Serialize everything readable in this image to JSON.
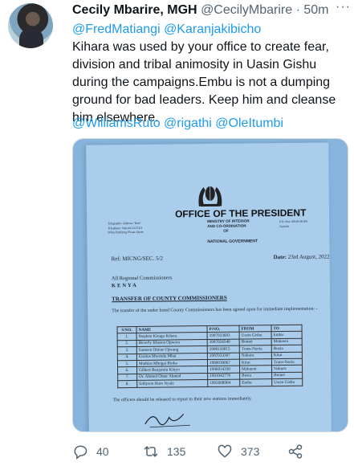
{
  "tweet": {
    "author_name": "Cecily Mbarire, MGH",
    "author_handle": "@CecilyMbarire",
    "separator": "·",
    "time": "50m",
    "mentions": "@FredMatiangi @Karanjakibicho",
    "text": "Kihara was used by your office to create fear, division  and tribal animosity in Uasin Gishu during the campaigns.Embu is not a dumping ground for bad leaders. Keep him and cleanse him elsewhere.",
    "tags": "@WilliamsRuto @rigathi @OleItumbi",
    "more_icon": "more-icon"
  },
  "letter": {
    "office": "OFFICE OF THE PRESIDENT",
    "ministry_lines": [
      "MINISTRY OF INTERIOR",
      "AND CO-ORDINATION",
      "OF"
    ],
    "government": "NATIONAL GOVERNMENT",
    "tel_lines": [
      "Telegraphic Address \"Rais\"",
      "Telephone: Nairobi 2227411",
      "When Replying Please Quote"
    ],
    "pobox_lines": [
      "P.O. Box 30510-00100",
      "Nairobi"
    ],
    "ref": "Ref:   MICNG/SEC. 5/2",
    "date_label": "Date:",
    "date_value": "23rd August, 2022",
    "addressee": "All Regional Commissioners",
    "country": "KENYA",
    "subject": "TRANSFER OF COUNTY COMMISSIONERS",
    "intro": "The transfer of the under listed County Commissioners has been agreed upon for immediate implementation: -",
    "table": {
      "headers": [
        "S/NO.",
        "NAME",
        "P/NO.",
        "FROM",
        "TO"
      ],
      "rows": [
        [
          "1.",
          "Stephen Kiragu Kihara",
          "1997023683",
          "Uasin Gishu",
          "Embu"
        ],
        [
          "2.",
          "Beverly Khasoa Opwora",
          "1997024540",
          "Bomet",
          "Makueni"
        ],
        [
          "3.",
          "Samson Otieno Ojwang",
          "1990110015",
          "Trans-Nzoia",
          "Busia"
        ],
        [
          "4.",
          "Esaitus Mwenda Mbai",
          "1997033387",
          "Nakuru",
          "Kitui"
        ],
        [
          "5.",
          "Mathias Mbogai Rioba",
          "1990030867",
          "Kitui",
          "Trans-Nzoia"
        ],
        [
          "6.",
          "Gilbert Benjamin Kitiyo",
          "1996014330",
          "Makueni",
          "Nakuru"
        ],
        [
          "7.",
          "Dr. Ahmed Omar Ahmed",
          "1991042778",
          "Busia",
          "Bomet"
        ],
        [
          "8.",
          "Eddyson Haro Nyale",
          "1995008904",
          "Embu",
          "Uasin Gishu"
        ]
      ]
    },
    "released": "The officers should be released to report to their new stations immediately."
  },
  "actions": {
    "reply_count": "40",
    "retweet_count": "135",
    "like_count": "373",
    "icons": [
      "reply-icon",
      "retweet-icon",
      "like-icon",
      "share-icon"
    ]
  },
  "colors": {
    "link": "#1d9bf0",
    "muted": "#536471",
    "text": "#0f1419",
    "paper": "#a9cdeb"
  }
}
